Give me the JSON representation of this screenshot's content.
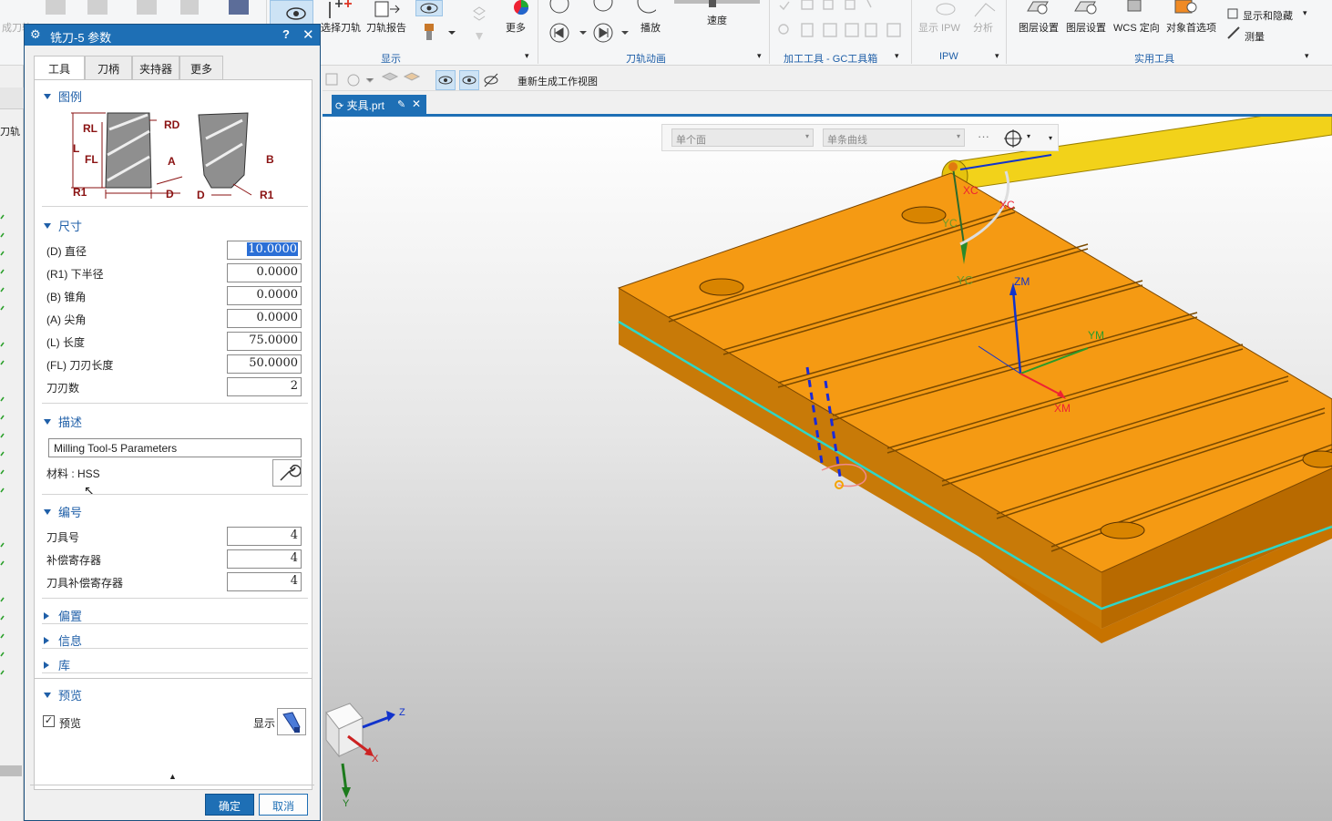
{
  "ribbon": {
    "buttons": {
      "select_toolpath": "选择刀轨",
      "toolpath_report": "刀轨报告",
      "more": "更多",
      "play": "播放",
      "speed": "速度",
      "show_ipw": "显示 IPW",
      "analyze": "分析",
      "layer_settings_1": "图层设置",
      "layer_settings_2": "图层设置",
      "wcs_orient": "WCS 定向",
      "object_prefs": "对象首选项",
      "show_hide": "显示和隐藏",
      "measure": "测量",
      "cut_label": "成刀轨"
    },
    "groups": {
      "display": "显示",
      "animation": "刀轨动画",
      "gc_toolbox": "加工工具 - GC工具箱",
      "ipw": "IPW",
      "utility": "实用工具"
    }
  },
  "toolbar2": {
    "regen": "重新生成工作视图"
  },
  "document_tab": {
    "name": "夹具.prt"
  },
  "selection_bar": {
    "filter1": "单个面",
    "filter2": "单条曲线"
  },
  "left_strip": {
    "label": "刀轨"
  },
  "viewport": {
    "axes": {
      "zm": "ZM",
      "ym": "YM",
      "xm": "XM",
      "xc": "XC",
      "yc": "YC",
      "x": "X",
      "y": "Y",
      "z": "Z"
    },
    "colors": {
      "plate": "#f59a13",
      "plate_side": "#c77300",
      "edge": "#2ed6c8"
    }
  },
  "dialog": {
    "title": "铣刀-5 参数",
    "help": "?",
    "tabs": [
      "工具",
      "刀柄",
      "夹持器",
      "更多"
    ],
    "sections": {
      "legend": "图例",
      "size": "尺寸",
      "desc": "描述",
      "numbering": "编号",
      "offset": "偏置",
      "info": "信息",
      "library": "库",
      "preview": "预览"
    },
    "legend_labels": {
      "rl": "RL",
      "rd": "RD",
      "l": "L",
      "fl": "FL",
      "a": "A",
      "r1": "R1",
      "d": "D",
      "b": "B"
    },
    "dims": [
      {
        "label": "(D) 直径",
        "value": "10.0000"
      },
      {
        "label": "(R1) 下半径",
        "value": "0.0000"
      },
      {
        "label": "(B) 锥角",
        "value": "0.0000"
      },
      {
        "label": "(A) 尖角",
        "value": "0.0000"
      },
      {
        "label": "(L) 长度",
        "value": "75.0000"
      },
      {
        "label": "(FL) 刀刃长度",
        "value": "50.0000"
      },
      {
        "label": "刀刃数",
        "value": "2"
      }
    ],
    "description": "Milling Tool-5 Parameters",
    "material": "材料 : HSS",
    "numbers": [
      {
        "label": "刀具号",
        "value": "4"
      },
      {
        "label": "补偿寄存器",
        "value": "4"
      },
      {
        "label": "刀具补偿寄存器",
        "value": "4"
      }
    ],
    "preview_checkbox": "预览",
    "display": "显示",
    "ok": "确定",
    "cancel": "取消"
  }
}
